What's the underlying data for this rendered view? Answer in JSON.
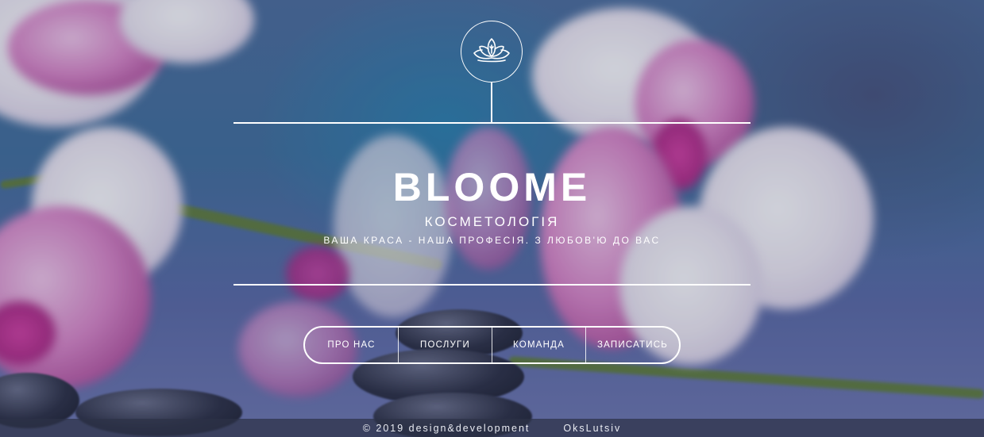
{
  "brand": {
    "name": "BLOOME",
    "subtitle": "КОСМЕТОЛОГІЯ",
    "tagline": "ВАША КРАСА - НАША ПРОФЕСІЯ. З ЛЮБОВ'Ю ДО ВАС",
    "logo_icon": "lotus-icon"
  },
  "nav": {
    "items": [
      {
        "label": "ПРО НАС"
      },
      {
        "label": "ПОСЛУГИ"
      },
      {
        "label": "КОМАНДА"
      },
      {
        "label": "ЗАПИСАТИСЬ"
      }
    ]
  },
  "footer": {
    "copyright": "© 2019 design&development",
    "author": "OksLutsiv"
  },
  "colors": {
    "text": "#ffffff",
    "footer_bg": "#2d3246"
  }
}
